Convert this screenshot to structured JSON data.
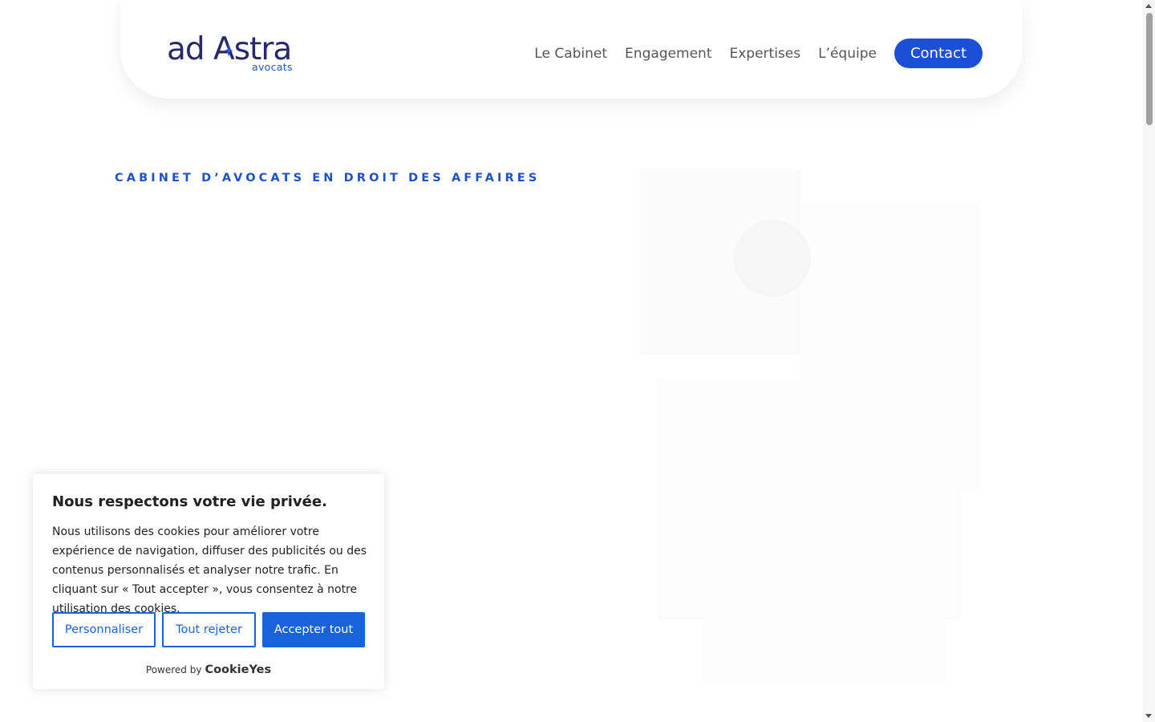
{
  "logo": {
    "name": "ad Astra",
    "subtitle": "avocats",
    "color": "#28286d",
    "accent": "#2b4fd6"
  },
  "nav": {
    "items": [
      "Le Cabinet",
      "Engagement",
      "Expertises",
      "L’équipe"
    ],
    "contact_label": "Contact",
    "accent_color": "#1b4fd8"
  },
  "hero": {
    "tagline": "CABINET D’AVOCATS EN DROIT DES AFFAIRES"
  },
  "cookie_banner": {
    "title": "Nous respectons votre vie privée.",
    "description": "Nous utilisons des cookies pour améliorer votre expérience de navigation, diffuser des publicités ou des contenus personnalisés et analyser notre trafic. En cliquant sur « Tout accepter », vous consentez à notre utilisation des cookies.",
    "customize_label": "Personnaliser",
    "reject_label": "Tout rejeter",
    "accept_label": "Accepter tout",
    "powered_by": "Powered by",
    "powered_brand": "CookieYes",
    "button_color": "#1863dc"
  }
}
